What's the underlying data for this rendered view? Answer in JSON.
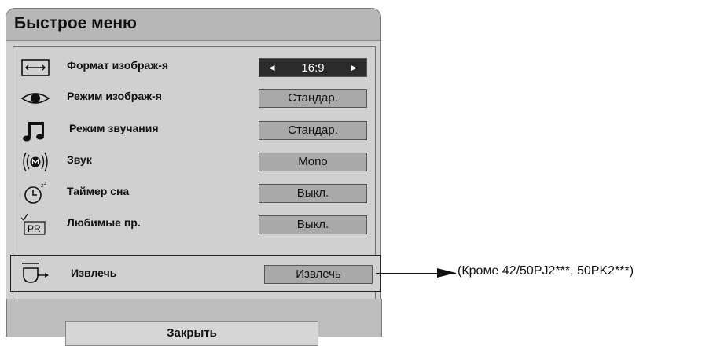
{
  "menu": {
    "title": "Быстрое меню",
    "items": [
      {
        "icon": "aspect-ratio-icon",
        "label": "Формат изображ-я",
        "value": "16:9",
        "selected": true
      },
      {
        "icon": "eye-icon",
        "label": "Режим изображ-я",
        "value": "Стандар."
      },
      {
        "icon": "music-note-icon",
        "label": "Режим звучания",
        "value": "Стандар."
      },
      {
        "icon": "mono-sound-icon",
        "label": "Звук",
        "value": "Mono"
      },
      {
        "icon": "sleep-timer-icon",
        "label": "Таймер сна",
        "value": "Выкл."
      },
      {
        "icon": "favorite-pr-icon",
        "label": "Любимые пр.",
        "value": "Выкл."
      },
      {
        "icon": "eject-icon",
        "label": "Извлечь",
        "value": "Извлечь",
        "highlighted": true
      }
    ],
    "close_label": "Закрыть",
    "arrows": {
      "left": "◄",
      "right": "►"
    }
  },
  "callout": {
    "text": "(Кроме  42/50PJ2***, 50PK2***)"
  },
  "colors": {
    "panel_bg": "#d0d0d0",
    "header_bg": "#b7b7b7",
    "value_bg": "#a9a9a9",
    "selected_value_bg": "#2b2b2b"
  }
}
